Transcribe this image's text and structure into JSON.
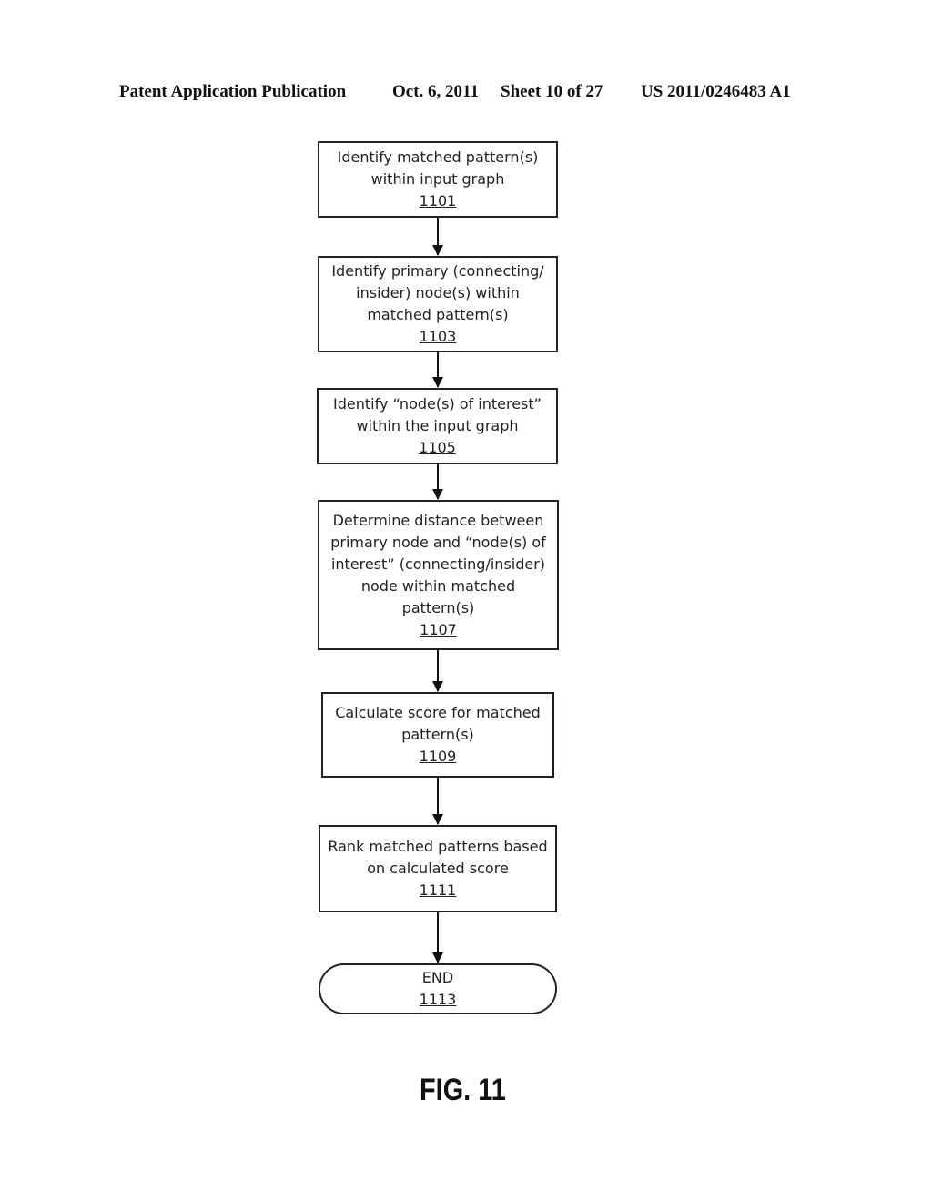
{
  "header": {
    "publication": "Patent Application Publication",
    "date": "Oct. 6, 2011",
    "sheet": "Sheet 10 of 27",
    "number": "US 2011/0246483 A1"
  },
  "flowchart": {
    "steps": [
      {
        "label": "Identify matched pattern(s)\nwithin input graph",
        "ref": "1101"
      },
      {
        "label": "Identify primary (connecting/\ninsider) node(s) within\nmatched pattern(s)",
        "ref": "1103"
      },
      {
        "label": "Identify “node(s) of interest”\nwithin the input graph",
        "ref": "1105"
      },
      {
        "label": "Determine distance between\nprimary node and “node(s) of\ninterest” (connecting/insider)\nnode within matched\npattern(s)",
        "ref": "1107"
      },
      {
        "label": "Calculate score for matched\npattern(s)",
        "ref": "1109"
      },
      {
        "label": "Rank matched patterns based\non calculated score",
        "ref": "1111"
      },
      {
        "label": "END",
        "ref": "1113"
      }
    ]
  },
  "figure_label": "FIG. 11"
}
